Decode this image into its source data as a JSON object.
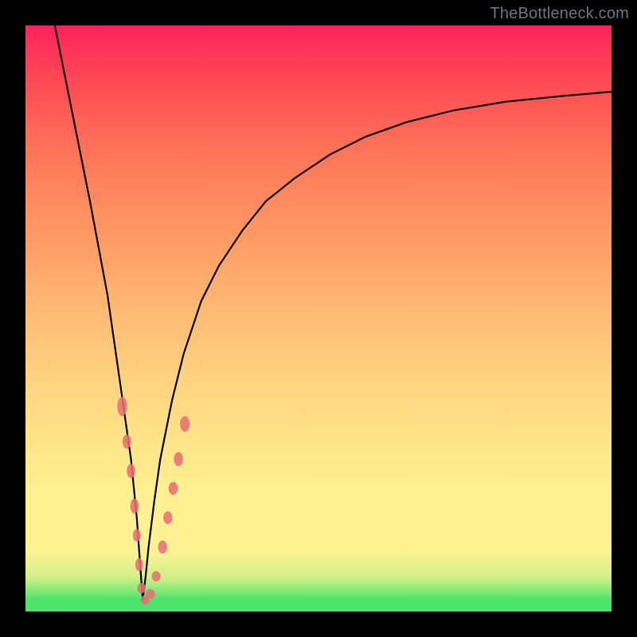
{
  "watermark": "TheBottleneck.com",
  "chart_data": {
    "type": "line",
    "title": "",
    "xlabel": "",
    "ylabel": "",
    "xlim": [
      0,
      100
    ],
    "ylim": [
      0,
      100
    ],
    "x_null": 20,
    "series": [
      {
        "name": "bottleneck-curve",
        "x": [
          5,
          8,
          11,
          14,
          16,
          18,
          19,
          19.5,
          20,
          20.5,
          21,
          22,
          23,
          25,
          27,
          30,
          33,
          37,
          41,
          46,
          52,
          58,
          65,
          73,
          82,
          92,
          100
        ],
        "y": [
          100,
          85,
          70,
          54,
          40,
          26,
          16,
          9,
          2,
          6,
          11,
          19,
          26,
          36,
          44,
          53,
          59,
          65,
          70,
          74,
          78,
          81,
          83.5,
          85.5,
          87,
          88,
          88.7
        ]
      }
    ],
    "markers": [
      {
        "name": "data-point",
        "x": 16.5,
        "y": 35,
        "rx": 1.5,
        "ry": 3
      },
      {
        "name": "data-point",
        "x": 17.3,
        "y": 29,
        "rx": 1.3,
        "ry": 2.2
      },
      {
        "name": "data-point",
        "x": 18.0,
        "y": 24,
        "rx": 1.3,
        "ry": 2.2
      },
      {
        "name": "data-point",
        "x": 18.6,
        "y": 18,
        "rx": 1.3,
        "ry": 2.3
      },
      {
        "name": "data-point",
        "x": 19.0,
        "y": 13,
        "rx": 1.2,
        "ry": 2.0
      },
      {
        "name": "data-point",
        "x": 19.4,
        "y": 8,
        "rx": 1.2,
        "ry": 2.0
      },
      {
        "name": "data-point",
        "x": 19.8,
        "y": 4,
        "rx": 1.3,
        "ry": 1.6
      },
      {
        "name": "data-point",
        "x": 20.4,
        "y": 2,
        "rx": 1.4,
        "ry": 1.4
      },
      {
        "name": "data-point",
        "x": 21.3,
        "y": 3,
        "rx": 1.5,
        "ry": 1.5
      },
      {
        "name": "data-point",
        "x": 22.3,
        "y": 6,
        "rx": 1.4,
        "ry": 1.6
      },
      {
        "name": "data-point",
        "x": 23.4,
        "y": 11,
        "rx": 1.4,
        "ry": 2.0
      },
      {
        "name": "data-point",
        "x": 24.3,
        "y": 16,
        "rx": 1.4,
        "ry": 2.0
      },
      {
        "name": "data-point",
        "x": 25.2,
        "y": 21,
        "rx": 1.4,
        "ry": 2.0
      },
      {
        "name": "data-point",
        "x": 26.1,
        "y": 26,
        "rx": 1.4,
        "ry": 2.2
      },
      {
        "name": "data-point",
        "x": 27.2,
        "y": 32,
        "rx": 1.5,
        "ry": 2.4
      }
    ],
    "colors": {
      "curve": "#000000",
      "marker": "#e76f73",
      "background_top": "#ff2060",
      "background_bottom": "#4be36a"
    }
  }
}
